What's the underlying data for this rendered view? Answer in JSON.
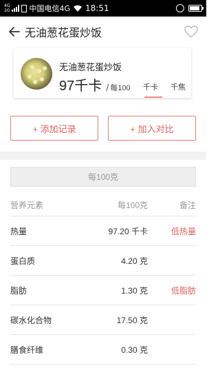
{
  "status_bar": {
    "signal_top": "4G",
    "signal_bottom": "2G",
    "carrier": "中国电信4G",
    "time": "18:51"
  },
  "header": {
    "title": "无油葱花蛋炒饭"
  },
  "food": {
    "name": "无油葱花蛋炒饭",
    "calories": "97千卡",
    "per_unit": "每100",
    "unit_active": "千卡",
    "unit_other": "千焦"
  },
  "actions": {
    "add_record": "+ 添加记录",
    "add_compare": "+ 加入对比"
  },
  "basis_tab": "每100克",
  "table": {
    "headers": {
      "nutrient": "营养元素",
      "per100": "每100克",
      "note": "备注"
    },
    "rows": [
      {
        "name": "热量",
        "value": "97.20 千卡",
        "note": "低热量"
      },
      {
        "name": "蛋白质",
        "value": "4.20 克",
        "note": ""
      },
      {
        "name": "脂肪",
        "value": "1.30 克",
        "note": "低脂肪"
      },
      {
        "name": "碳水化合物",
        "value": "17.50 克",
        "note": ""
      },
      {
        "name": "膳食纤维",
        "value": "0.30 克",
        "note": ""
      }
    ]
  },
  "colors": {
    "accent": "#e0605f",
    "accent_border": "#e87c7c"
  }
}
